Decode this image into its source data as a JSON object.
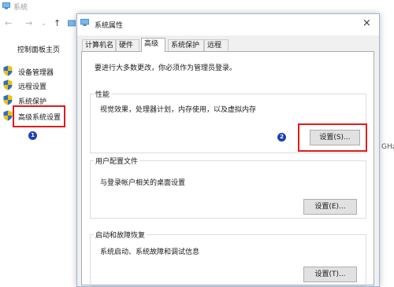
{
  "background_window": {
    "title": "系统",
    "sidebar_home": "控制面板主页",
    "sidebar_items": [
      {
        "label": "设备管理器",
        "icon": "shield-icon"
      },
      {
        "label": "远程设置",
        "icon": "shield-icon"
      },
      {
        "label": "系统保护",
        "icon": "shield-icon"
      },
      {
        "label": "高级系统设置",
        "icon": "shield-icon"
      }
    ],
    "right_clipped_text": "GHz",
    "step_badge": "1"
  },
  "dialog": {
    "title": "系统属性",
    "close_glyph": "×",
    "tabs": [
      {
        "label": "计算机名",
        "active": false
      },
      {
        "label": "硬件",
        "active": false
      },
      {
        "label": "高级",
        "active": true
      },
      {
        "label": "系统保护",
        "active": false
      },
      {
        "label": "远程",
        "active": false
      }
    ],
    "admin_note": "要进行大多数更改，你必须作为管理员登录。",
    "groups": {
      "performance": {
        "title": "性能",
        "description": "视觉效果，处理器计划，内存使用，以及虚拟内存",
        "button": "设置(S)...",
        "step_badge": "2"
      },
      "user_profiles": {
        "title": "用户配置文件",
        "description": "与登录帐户相关的桌面设置",
        "button": "设置(E)..."
      },
      "startup_recovery": {
        "title": "启动和故障恢复",
        "description": "系统启动、系统故障和调试信息",
        "button": "设置(T)..."
      }
    }
  },
  "colors": {
    "highlight_red": "#e01b1b",
    "callout_blue": "#1f3fb5",
    "dialog_bg": "#f0f0f0"
  }
}
